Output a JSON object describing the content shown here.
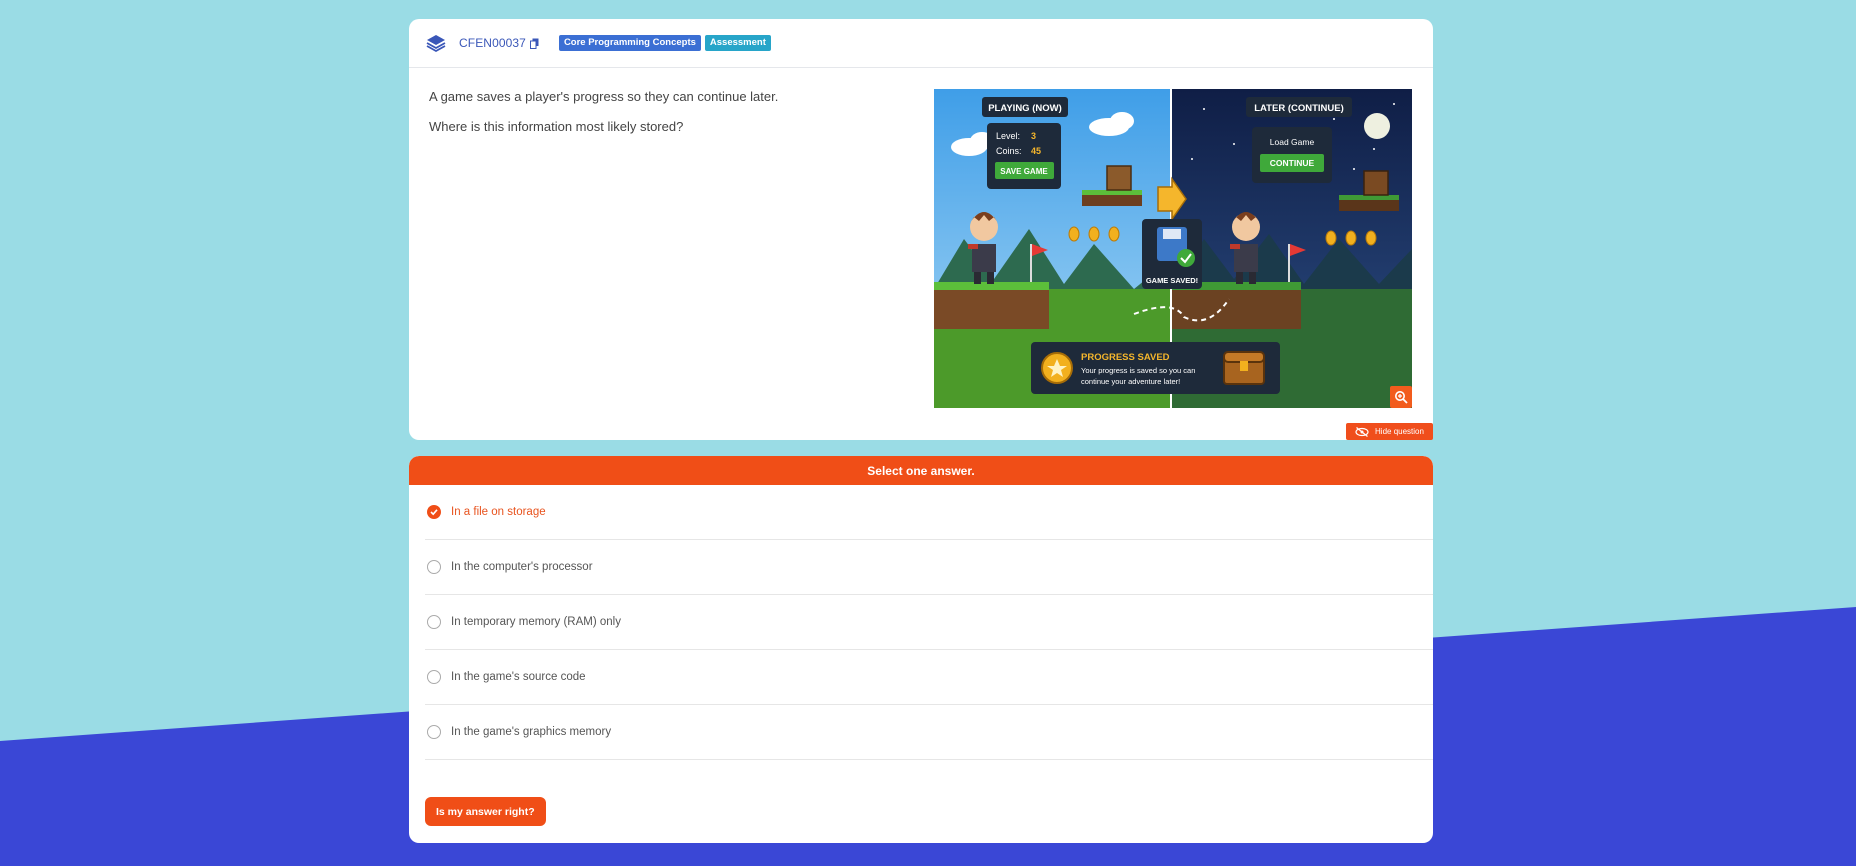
{
  "header": {
    "question_id": "CFEN00037",
    "tags": [
      "Core Programming Concepts",
      "Assessment"
    ]
  },
  "question": {
    "lines": [
      "A game saves a player's progress so they can continue later.",
      "Where is this information most likely stored?"
    ],
    "image": {
      "left_banner": "PLAYING (NOW)",
      "right_banner": "LATER (CONTINUE)",
      "level_label": "Level:",
      "level_value": "3",
      "coins_label": "Coins:",
      "coins_value": "45",
      "save_button": "SAVE GAME",
      "load_label": "Load Game",
      "continue_button": "CONTINUE",
      "saved_label": "GAME SAVED!",
      "progress_title": "PROGRESS SAVED",
      "progress_text_1": "Your progress is saved so you can",
      "progress_text_2": "continue your adventure later!"
    },
    "hide_label": "Hide question"
  },
  "answers": {
    "instruction": "Select one answer.",
    "options": [
      {
        "label": "In a file on storage",
        "selected": true
      },
      {
        "label": "In the computer's processor",
        "selected": false
      },
      {
        "label": "In temporary memory (RAM) only",
        "selected": false
      },
      {
        "label": "In the game's source code",
        "selected": false
      },
      {
        "label": "In the game's graphics memory",
        "selected": false
      }
    ],
    "check_label": "Is my answer right?"
  },
  "colors": {
    "accent": "#f04e17",
    "background_top": "#9adce5",
    "background_bottom": "#3a47d6",
    "tag_topic": "#3b6fd4",
    "tag_type": "#27a5c9"
  }
}
